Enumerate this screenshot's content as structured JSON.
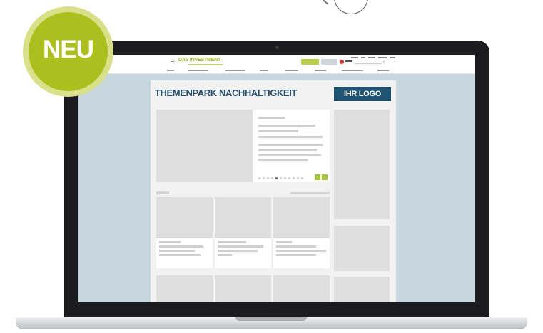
{
  "badge": {
    "label": "NEU"
  },
  "site": {
    "brand": "DAS INVESTMENT",
    "menu_icon": "hamburger-icon",
    "search_icon": "search-icon"
  },
  "page": {
    "title": "THEMENPARK NACHHALTIGKEIT",
    "logo_placeholder": "IHR LOGO"
  },
  "slider": {
    "prev_label": "‹",
    "next_label": "›",
    "slide_count": 11,
    "active_slide": 5
  },
  "colors": {
    "accent_green": "#acbf1e",
    "badge_outer": "#d9e089",
    "title_blue": "#264f6e",
    "logo_box": "#1f5572",
    "backdrop": "#c6d6dc"
  }
}
